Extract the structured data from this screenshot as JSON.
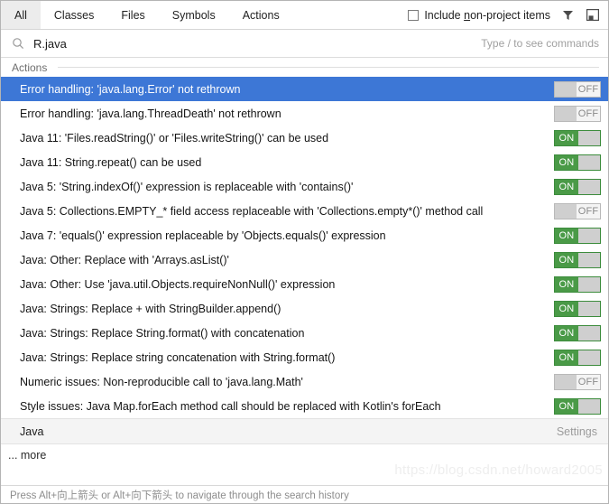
{
  "tabs": [
    {
      "label": "All",
      "selected": true
    },
    {
      "label": "Classes",
      "selected": false
    },
    {
      "label": "Files",
      "selected": false
    },
    {
      "label": "Symbols",
      "selected": false
    },
    {
      "label": "Actions",
      "selected": false
    }
  ],
  "header": {
    "include_checkbox": {
      "label_before": "Include ",
      "mnemonic": "n",
      "label_after": "on-project items",
      "checked": false
    },
    "filter_icon": "filter-funnel-icon",
    "panel_icon": "toggle-panel-icon"
  },
  "search": {
    "icon": "search-icon",
    "value": "R.java",
    "hint": "Type / to see commands"
  },
  "group": {
    "title": "Actions"
  },
  "results": [
    {
      "label": "Error handling: 'java.lang.Error' not rethrown",
      "toggle": "OFF",
      "selected": true
    },
    {
      "label": "Error handling: 'java.lang.ThreadDeath' not rethrown",
      "toggle": "OFF",
      "selected": false
    },
    {
      "label": "Java 11: 'Files.readString()' or 'Files.writeString()' can be used",
      "toggle": "ON",
      "selected": false
    },
    {
      "label": "Java 11: String.repeat() can be used",
      "toggle": "ON",
      "selected": false
    },
    {
      "label": "Java 5: 'String.indexOf()' expression is replaceable with 'contains()'",
      "toggle": "ON",
      "selected": false
    },
    {
      "label": "Java 5: Collections.EMPTY_* field access replaceable with 'Collections.empty*()' method call",
      "toggle": "OFF",
      "selected": false
    },
    {
      "label": "Java 7: 'equals()' expression replaceable by 'Objects.equals()' expression",
      "toggle": "ON",
      "selected": false
    },
    {
      "label": "Java: Other: Replace with 'Arrays.asList()'",
      "toggle": "ON",
      "selected": false
    },
    {
      "label": "Java: Other: Use 'java.util.Objects.requireNonNull()' expression",
      "toggle": "ON",
      "selected": false
    },
    {
      "label": "Java: Strings: Replace + with StringBuilder.append()",
      "toggle": "ON",
      "selected": false
    },
    {
      "label": "Java: Strings: Replace String.format() with concatenation",
      "toggle": "ON",
      "selected": false
    },
    {
      "label": "Java: Strings: Replace string concatenation with String.format()",
      "toggle": "ON",
      "selected": false
    },
    {
      "label": "Numeric issues: Non-reproducible call to 'java.lang.Math'",
      "toggle": "OFF",
      "selected": false
    },
    {
      "label": "Style issues: Java Map.forEach method call should be replaced with Kotlin's forEach",
      "toggle": "ON",
      "selected": false
    }
  ],
  "settings_row": {
    "category": "Java",
    "action": "Settings"
  },
  "more": {
    "label": "... more"
  },
  "watermark": {
    "text": "https://blog.csdn.net/howard2005"
  },
  "statusbar": {
    "text": "Press Alt+向上箭头 or Alt+向下箭头 to navigate through the search history"
  },
  "colors": {
    "selection_blue": "#3d77d6",
    "toggle_on_green": "#4a9a47",
    "toggle_knob_gray": "#cfcfcf",
    "settings_row_bg": "#f4f4f4"
  }
}
